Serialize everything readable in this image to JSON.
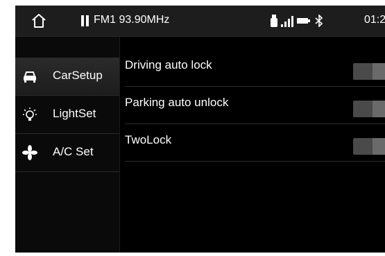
{
  "status_bar": {
    "radio": "FM1 93.90MHz",
    "time": "01:2",
    "icons": [
      "home-icon",
      "pause-icon",
      "usb-icon",
      "signal-icon",
      "battery-icon",
      "bluetooth-icon"
    ]
  },
  "sidebar": {
    "items": [
      {
        "label": "CarSetup",
        "icon": "car-icon",
        "active": true
      },
      {
        "label": "LightSet",
        "icon": "bulb-icon",
        "active": false
      },
      {
        "label": "A/C Set",
        "icon": "fan-icon",
        "active": false
      }
    ]
  },
  "settings": [
    {
      "label": "Driving auto lock",
      "state": "off"
    },
    {
      "label": "Parking auto unlock",
      "state": "off"
    },
    {
      "label": "TwoLock",
      "state": "off"
    }
  ],
  "colors": {
    "background": "#000000",
    "status_bar": "#1d1d1d",
    "toggle": "#4a4a4a",
    "text": "#ffffff"
  }
}
